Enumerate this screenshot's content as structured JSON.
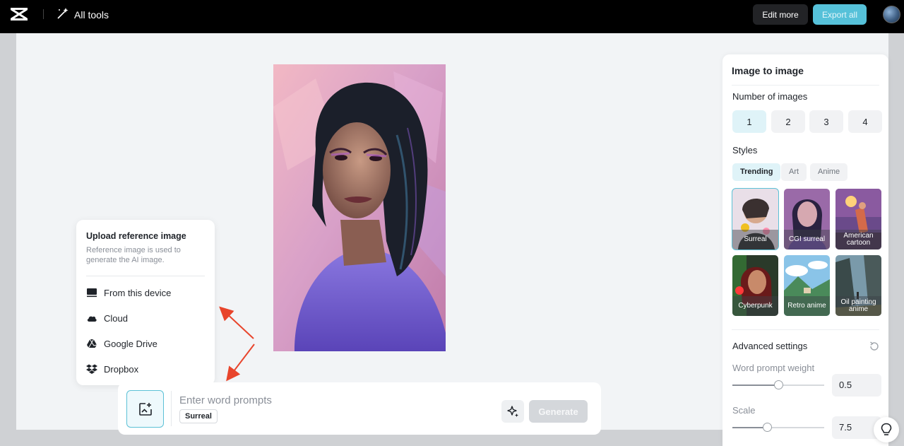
{
  "topbar": {
    "tools_label": "All tools",
    "edit_label": "Edit more",
    "export_label": "Export all"
  },
  "upload_menu": {
    "title": "Upload reference image",
    "description": "Reference image is used to generate the AI image.",
    "items": [
      {
        "label": "From this device",
        "icon": "monitor-icon"
      },
      {
        "label": "Cloud",
        "icon": "cloud-icon"
      },
      {
        "label": "Google Drive",
        "icon": "google-drive-icon"
      },
      {
        "label": "Dropbox",
        "icon": "dropbox-icon"
      }
    ]
  },
  "prompt": {
    "placeholder": "Enter word prompts",
    "style_chip": "Surreal",
    "generate_label": "Generate"
  },
  "panel": {
    "title": "Image to image",
    "number_label": "Number of images",
    "numbers": [
      "1",
      "2",
      "3",
      "4"
    ],
    "selected_number": "1",
    "styles_label": "Styles",
    "style_tabs": [
      "Trending",
      "Art",
      "Anime"
    ],
    "active_tab": "Trending",
    "styles": [
      {
        "label": "Surreal",
        "selected": true
      },
      {
        "label": "CGI surreal",
        "selected": false
      },
      {
        "label": "American cartoon",
        "selected": false
      },
      {
        "label": "Cyberpunk",
        "selected": false
      },
      {
        "label": "Retro anime",
        "selected": false
      },
      {
        "label": "Oil painting anime",
        "selected": false
      }
    ],
    "advanced_label": "Advanced settings",
    "word_weight_label": "Word prompt weight",
    "word_weight_value": "0.5",
    "word_weight_fraction": 0.5,
    "scale_label": "Scale",
    "scale_value": "7.5",
    "scale_fraction": 0.38
  },
  "colors": {
    "accent": "#56c1d9",
    "topbar": "#000000",
    "canvas": "#f2f4f6"
  }
}
